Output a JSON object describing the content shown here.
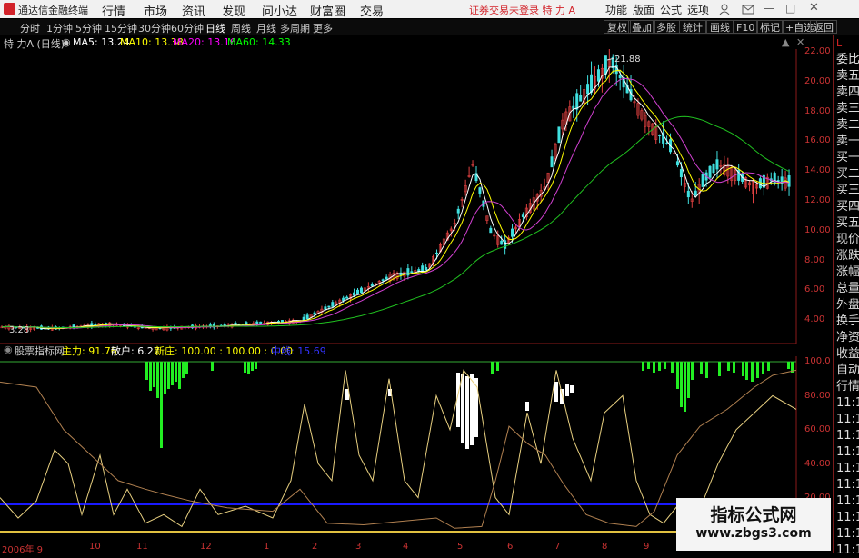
{
  "titlebar": {
    "app_name": "通达信金融终端",
    "menus": [
      "行情",
      "市场",
      "资讯",
      "发现",
      "问小达",
      "财富圈",
      "交易"
    ],
    "status": "证券交易未登录  特 力 A",
    "right_items": [
      "功能",
      "版面",
      "公式",
      "选项"
    ],
    "guest": "游客"
  },
  "toolbar": {
    "periods": [
      "分时",
      "1分钟",
      "5分钟",
      "15分钟",
      "30分钟",
      "60分钟",
      "日线",
      "周线",
      "月线",
      "多周期",
      "更多"
    ],
    "active_period": "日线",
    "right_buttons": [
      "复权",
      "叠加",
      "多股",
      "统计",
      "画线",
      "F10",
      "标记",
      "+自选",
      "返回"
    ]
  },
  "main_chart": {
    "stock": "特 力A (日线)",
    "ma": [
      {
        "label": "MA5: 13.24",
        "color": "#ffffff"
      },
      {
        "label": "MA10: 13.38",
        "color": "#ffff00"
      },
      {
        "label": "MA20: 13.16",
        "color": "#ff00ff"
      },
      {
        "label": "MA60: 14.33",
        "color": "#00ff00"
      }
    ],
    "high_label": "21.88",
    "low_label": "3.28",
    "y_ticks": [
      "22.00",
      "20.00",
      "18.00",
      "16.00",
      "14.00",
      "12.00",
      "10.00",
      "8.00",
      "6.00",
      "4.00"
    ]
  },
  "indicator": {
    "name": "股票指标网",
    "main_label": "主力: 91.76",
    "retail_label": "散户: 6.27",
    "new_label": "新庄: 100.00 : 100.00 : 0.00",
    "mid_label": "中线: 15.69",
    "y_ticks": [
      "100.0",
      "80.00",
      "60.00",
      "40.00",
      "20.00"
    ]
  },
  "date_axis": [
    "2006年 9",
    "10",
    "11",
    "12",
    "1",
    "2",
    "3",
    "4",
    "5",
    "6",
    "7",
    "8",
    "9",
    "10"
  ],
  "side_panel": [
    "L",
    "委比",
    "卖五",
    "卖四",
    "卖三",
    "卖二",
    "卖一",
    "买一",
    "买二",
    "买三",
    "买四",
    "买五",
    "现价",
    "涨跌",
    "涨幅",
    "总量",
    "外盘",
    "换手",
    "净资",
    "收益",
    "自动",
    "行情",
    "11:1",
    "11:1",
    "11:1",
    "11:1",
    "11:1",
    "11:1",
    "11:1",
    "11:1",
    "11:1",
    "11:1"
  ],
  "watermark": {
    "line1": "指标公式网",
    "line2": "www.zbgs3.com"
  }
}
